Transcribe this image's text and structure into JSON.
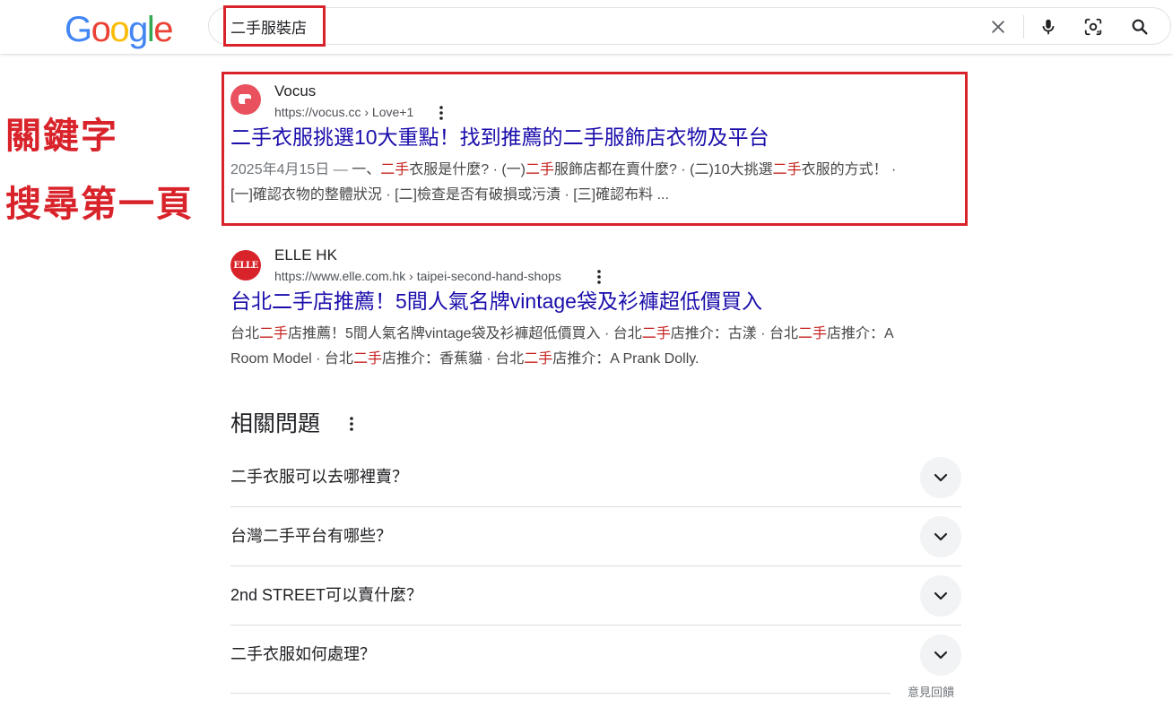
{
  "header": {
    "logo_letters": [
      {
        "char": "G",
        "color": "#4285F4"
      },
      {
        "char": "o",
        "color": "#EA4335"
      },
      {
        "char": "o",
        "color": "#FBBC05"
      },
      {
        "char": "g",
        "color": "#4285F4"
      },
      {
        "char": "l",
        "color": "#34A853"
      },
      {
        "char": "e",
        "color": "#EA4335"
      }
    ],
    "search_query": "二手服裝店",
    "icons": [
      "clear-icon",
      "microphone-icon",
      "lens-icon",
      "search-icon"
    ]
  },
  "annotation": {
    "line1": "關鍵字",
    "line2": "搜尋第一頁",
    "color": "#d9232b"
  },
  "results": [
    {
      "site_name": "Vocus",
      "url": "https://vocus.cc › Love+1",
      "title": "二手衣服挑選10大重點！找到推薦的二手服飾店衣物及平台",
      "date": "2025年4月15日 — ",
      "snippet_line1": [
        {
          "text": "一、",
          "hl": false
        },
        {
          "text": "二手",
          "hl": true
        },
        {
          "text": "衣服是什麼? · (一)",
          "hl": false
        },
        {
          "text": "二手",
          "hl": true
        },
        {
          "text": "服飾店都在賣什麼? · (二)10大挑選",
          "hl": false
        },
        {
          "text": "二手",
          "hl": true
        },
        {
          "text": "衣服的方式！ ·",
          "hl": false
        }
      ],
      "snippet_line2": "[一]確認衣物的整體狀況 · [二]檢查是否有破損或污漬 · [三]確認布料 ...",
      "favicon_color": "#e8515d"
    },
    {
      "site_name": "ELLE HK",
      "url": "https://www.elle.com.hk › taipei-second-hand-shops",
      "title": "台北二手店推薦！5間人氣名牌vintage袋及衫褲超低價買入",
      "favicon_text": "ELLE",
      "snippet_line1": [
        {
          "text": "台北",
          "hl": false
        },
        {
          "text": "二手",
          "hl": true
        },
        {
          "text": "店推薦！5間人氣名牌vintage袋及衫褲超低價買入 · 台北",
          "hl": false
        },
        {
          "text": "二手",
          "hl": true
        },
        {
          "text": "店推介：古漾 · 台北",
          "hl": false
        },
        {
          "text": "二手",
          "hl": true
        },
        {
          "text": "店推介：A",
          "hl": false
        }
      ],
      "snippet_line2": [
        {
          "text": "Room Model · 台北",
          "hl": false
        },
        {
          "text": "二手",
          "hl": true
        },
        {
          "text": "店推介：香蕉貓 · 台北",
          "hl": false
        },
        {
          "text": "二手",
          "hl": true
        },
        {
          "text": "店推介：A Prank Dolly.",
          "hl": false
        }
      ],
      "favicon_color": "#d9232b"
    }
  ],
  "related_questions": {
    "title": "相關問題",
    "items": [
      "二手衣服可以去哪裡賣？",
      "台灣二手平台有哪些？",
      "2nd STREET可以賣什麼？",
      "二手衣服如何處理？"
    ],
    "feedback": "意見回饋"
  }
}
